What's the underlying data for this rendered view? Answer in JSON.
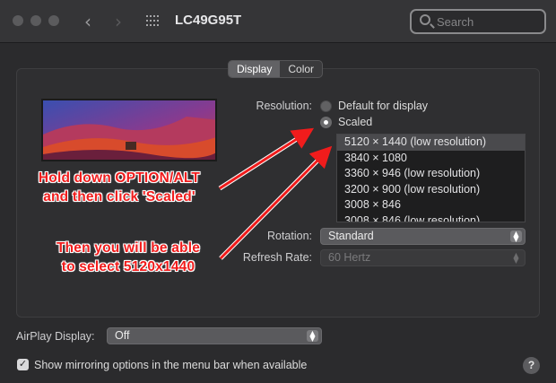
{
  "window": {
    "title": "LC49G95T",
    "search_placeholder": "Search"
  },
  "tabs": [
    {
      "label": "Display",
      "active": true
    },
    {
      "label": "Color",
      "active": false
    }
  ],
  "resolution": {
    "label": "Resolution:",
    "options": [
      {
        "label": "Default for display",
        "selected": false
      },
      {
        "label": "Scaled",
        "selected": true
      }
    ],
    "list": [
      {
        "label": "5120 × 1440 (low resolution)",
        "selected": true
      },
      {
        "label": "3840 × 1080",
        "selected": false
      },
      {
        "label": "3360 × 946 (low resolution)",
        "selected": false
      },
      {
        "label": "3200 × 900 (low resolution)",
        "selected": false
      },
      {
        "label": "3008 × 846",
        "selected": false
      },
      {
        "label": "3008 × 846 (low resolution)",
        "selected": false
      }
    ]
  },
  "rotation": {
    "label": "Rotation:",
    "value": "Standard"
  },
  "refresh_rate": {
    "label": "Refresh Rate:",
    "value": "60 Hertz"
  },
  "airplay": {
    "label": "AirPlay Display:",
    "value": "Off"
  },
  "mirroring": {
    "label": "Show mirroring options in the menu bar when available",
    "checked": true
  },
  "annotations": {
    "first_line1": "Hold down OPTION/ALT",
    "first_line2": "and then click 'Scaled'",
    "second_line1": "Then you will be able",
    "second_line2": "to select 5120x1440"
  },
  "help_label": "?",
  "colors": {
    "background": "#2b2b2d",
    "annotation": "#f01c1c",
    "selected_row": "#4a4a4d"
  },
  "icons": [
    "close-icon",
    "minimize-icon",
    "zoom-icon",
    "back-chevron-icon",
    "forward-chevron-icon",
    "grid-icon",
    "search-icon",
    "popup-arrows-icon",
    "checkmark-icon",
    "help-icon",
    "arrow-icon"
  ]
}
